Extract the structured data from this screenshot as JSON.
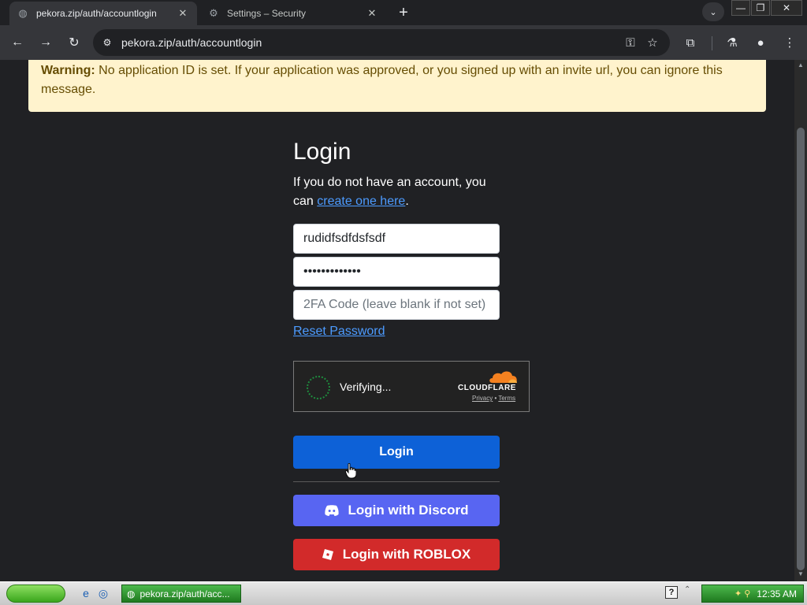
{
  "browser": {
    "tabs": [
      {
        "title": "pekora.zip/auth/accountlogin",
        "active": true
      },
      {
        "title": "Settings – Security",
        "active": false
      }
    ],
    "new_tab_label": "+",
    "url": "pekora.zip/auth/accountlogin",
    "icons": {
      "back": "←",
      "forward": "→",
      "reload": "↻",
      "tune": "⚙",
      "key": "⚿",
      "star": "☆",
      "extensions": "⧉",
      "labs": "⚗",
      "profile": "●",
      "menu": "⋮",
      "tab_search": "⌄",
      "minimize": "—",
      "maximize": "❐",
      "close": "✕",
      "tab_close": "✕",
      "settings_fav": "⚙",
      "site_fav": "◍"
    }
  },
  "page": {
    "warning": {
      "label": "Warning:",
      "text": " No application ID is set. If your application was approved, or you signed up with an invite url, you can ignore this message."
    },
    "login": {
      "title": "Login",
      "desc_prefix": "If you do not have an account, you can ",
      "create_link": "create one here",
      "desc_suffix": ".",
      "username_value": "rudidfsdfdsfsdf",
      "password_value": "•••••••••••••",
      "twofa_placeholder": "2FA Code (leave blank if not set)",
      "reset_link": "Reset Password",
      "login_button": "Login",
      "discord_button": "Login with Discord",
      "roblox_button": "Login with ROBLOX"
    },
    "captcha": {
      "status": "Verifying...",
      "brand": "CLOUDFLARE",
      "privacy": "Privacy",
      "dot": "•",
      "terms": "Terms"
    }
  },
  "taskbar": {
    "task_title": "pekora.zip/auth/acc...",
    "help": "?",
    "tray_arrow": "⌃",
    "tray_icons": "✦ ⚲",
    "time": "12:35 AM",
    "quick_icons": [
      "e",
      "◎"
    ]
  },
  "colors": {
    "login_button": "#0d61d7",
    "discord": "#5865f2",
    "roblox": "#d22a2a",
    "warning_bg": "#fff3cd",
    "link": "#4c9bff",
    "cloudflare_orange": "#f48120"
  }
}
